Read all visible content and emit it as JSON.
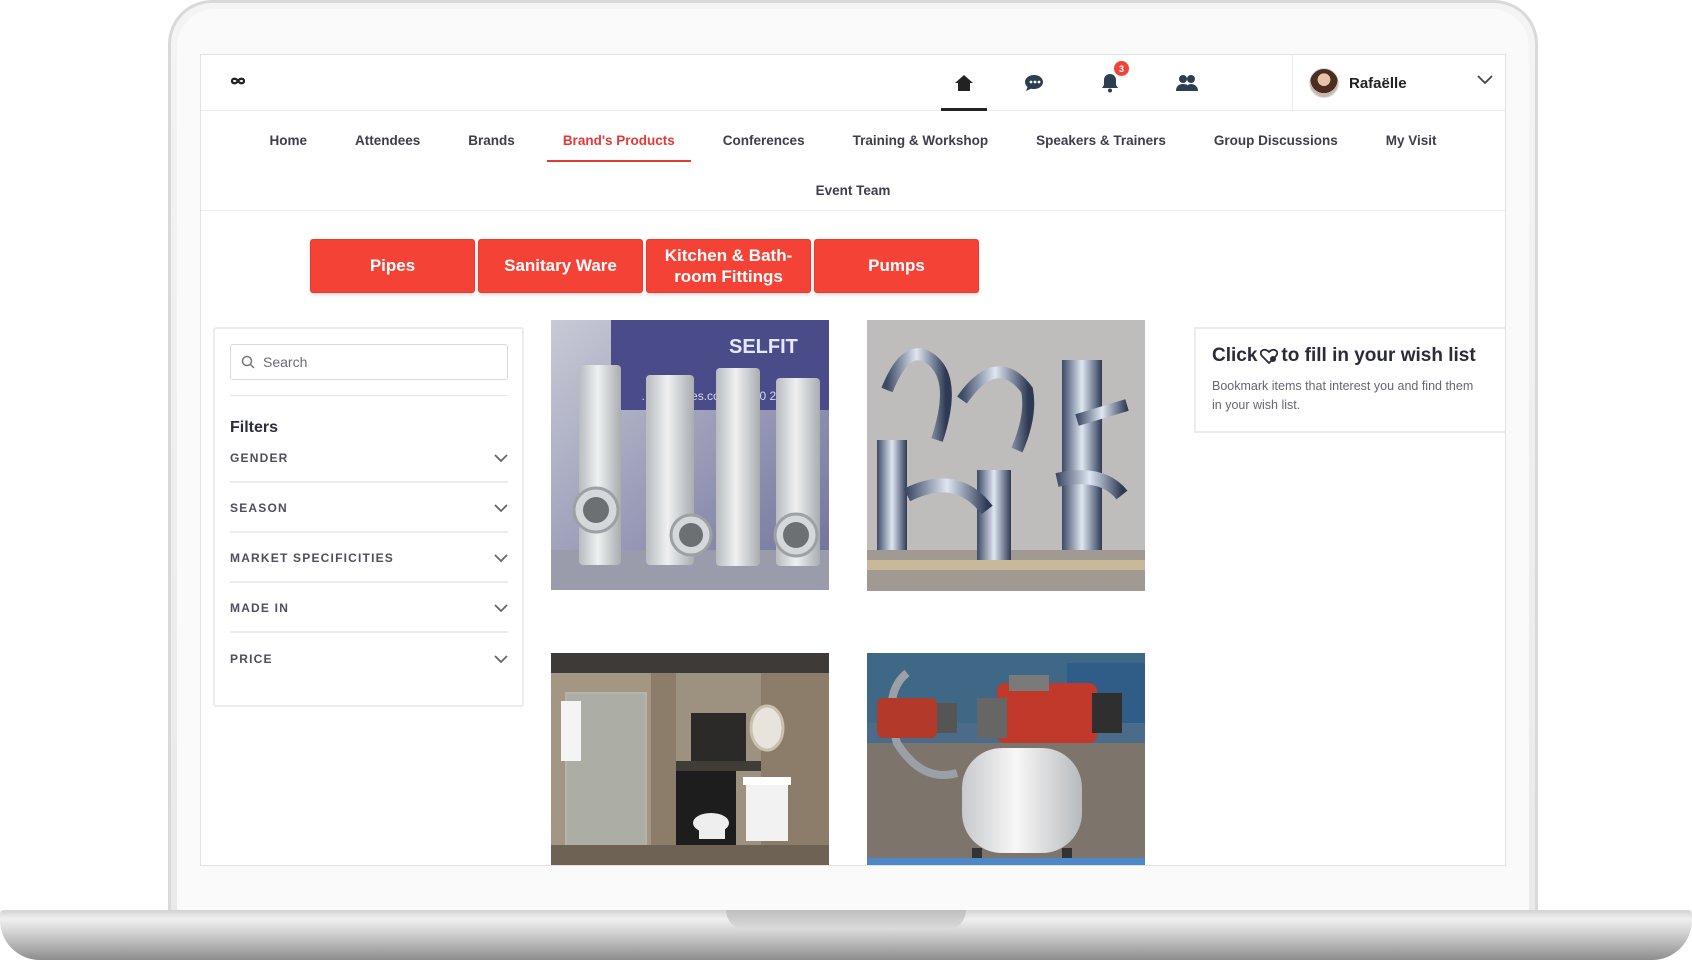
{
  "topbar": {
    "icons": [
      "home-icon",
      "chat-icon",
      "bell-icon",
      "people-icon"
    ],
    "notification_count": "3",
    "user_name": "Rafaëlle"
  },
  "nav": {
    "row1": [
      "Home",
      "Attendees",
      "Brands",
      "Brand's Products",
      "Conferences",
      "Training & Workshop",
      "Speakers & Trainers",
      "Group Discussions",
      "My Visit"
    ],
    "row2": [
      "Event Team"
    ],
    "active": "Brand's Products"
  },
  "categories": [
    "Pipes",
    "Sanitary Ware",
    "Kitchen & Bath-room Fittings",
    "Pumps"
  ],
  "sidebar": {
    "search_placeholder": "Search",
    "filters_title": "Filters",
    "filters": [
      "GENDER",
      "SEASON",
      "MARKET SPECIFICITIES",
      "MADE IN",
      "PRICE"
    ]
  },
  "products": {
    "pipes_banner": "SELFIT",
    "pipes_banner_sub": "…playpipes.com | 1800 2…"
  },
  "wishlist": {
    "title_before": "Click",
    "title_after": "to fill in your wish list",
    "description": "Bookmark items that interest you and find them in your wish list."
  },
  "colors": {
    "accent": "#f44336",
    "nav_text": "#3d3d4d"
  }
}
